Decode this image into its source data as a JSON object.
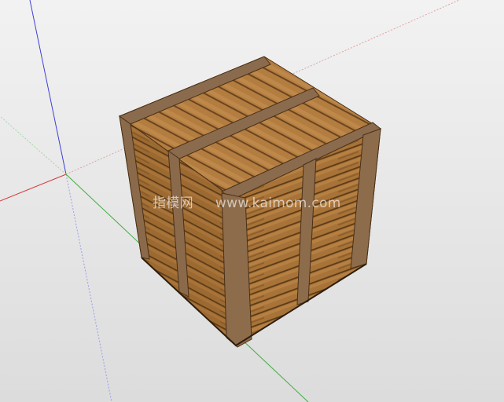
{
  "viewport": {
    "background_color": "#ffffff",
    "ground_color": "#d6d6d6",
    "sky_color": "#e6e6e6"
  },
  "axes": {
    "red_color": "#d43a3a",
    "green_color": "#3fae3f",
    "blue_color": "#3f3fd6"
  },
  "model": {
    "name": "wooden-crate",
    "wood_light": "#b07a3e",
    "wood_mid": "#96652e",
    "wood_dark": "#6f4a22",
    "frame_color": "#8a6a4a"
  },
  "watermark": {
    "brand_text": "指模网",
    "url_text": "www.kaimom.com"
  }
}
